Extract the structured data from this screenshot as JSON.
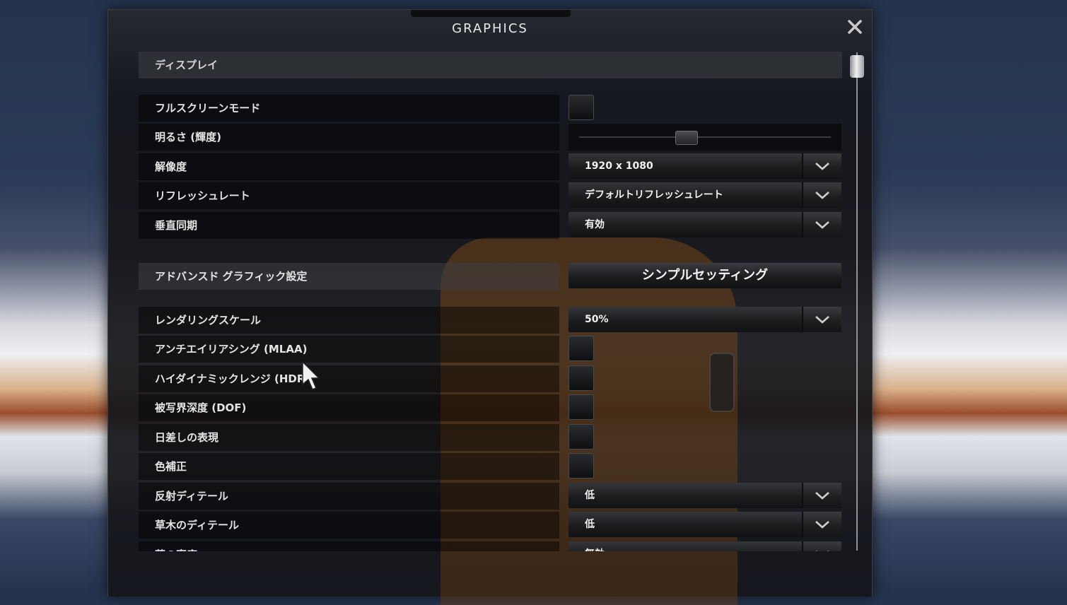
{
  "window": {
    "title": "GRAPHICS"
  },
  "display_section": {
    "header": "ディスプレイ",
    "fullscreen": {
      "label": "フルスクリーンモード",
      "checked": false
    },
    "brightness": {
      "label": "明るさ (輝度)",
      "level": 0.42
    },
    "resolution": {
      "label": "解像度",
      "value": "1920 x 1080"
    },
    "refresh_rate": {
      "label": "リフレッシュレート",
      "value": "デフォルトリフレッシュレート"
    },
    "vsync": {
      "label": "垂直同期",
      "value": "有効"
    }
  },
  "advanced": {
    "label": "アドバンスド グラフィック設定",
    "button_label": "シンプルセッティング"
  },
  "settings": {
    "rendering_scale": {
      "label": "レンダリングスケール",
      "value": "50%"
    },
    "mlaa": {
      "label": "アンチエイリアシング (MLAA)",
      "checked": false
    },
    "hdr": {
      "label": "ハイダイナミックレンジ (HDR",
      "checked": false
    },
    "dof": {
      "label": "被写界深度 (DOF)",
      "checked": false
    },
    "sun_shafts": {
      "label": "日差しの表現",
      "checked": false
    },
    "color_correction": {
      "label": "色補正",
      "checked": false
    },
    "reflection_detail": {
      "label": "反射ディテール",
      "value": "低"
    },
    "vegetation_detail": {
      "label": "草木のディテール",
      "value": "低"
    },
    "grass_density": {
      "label": "草の密度",
      "value": "無効"
    }
  },
  "icons": {
    "close": "close-icon",
    "dropdown": "chevron-down-icon",
    "cursor": "mouse-cursor-icon"
  },
  "scroll": {
    "position": 0.0
  }
}
